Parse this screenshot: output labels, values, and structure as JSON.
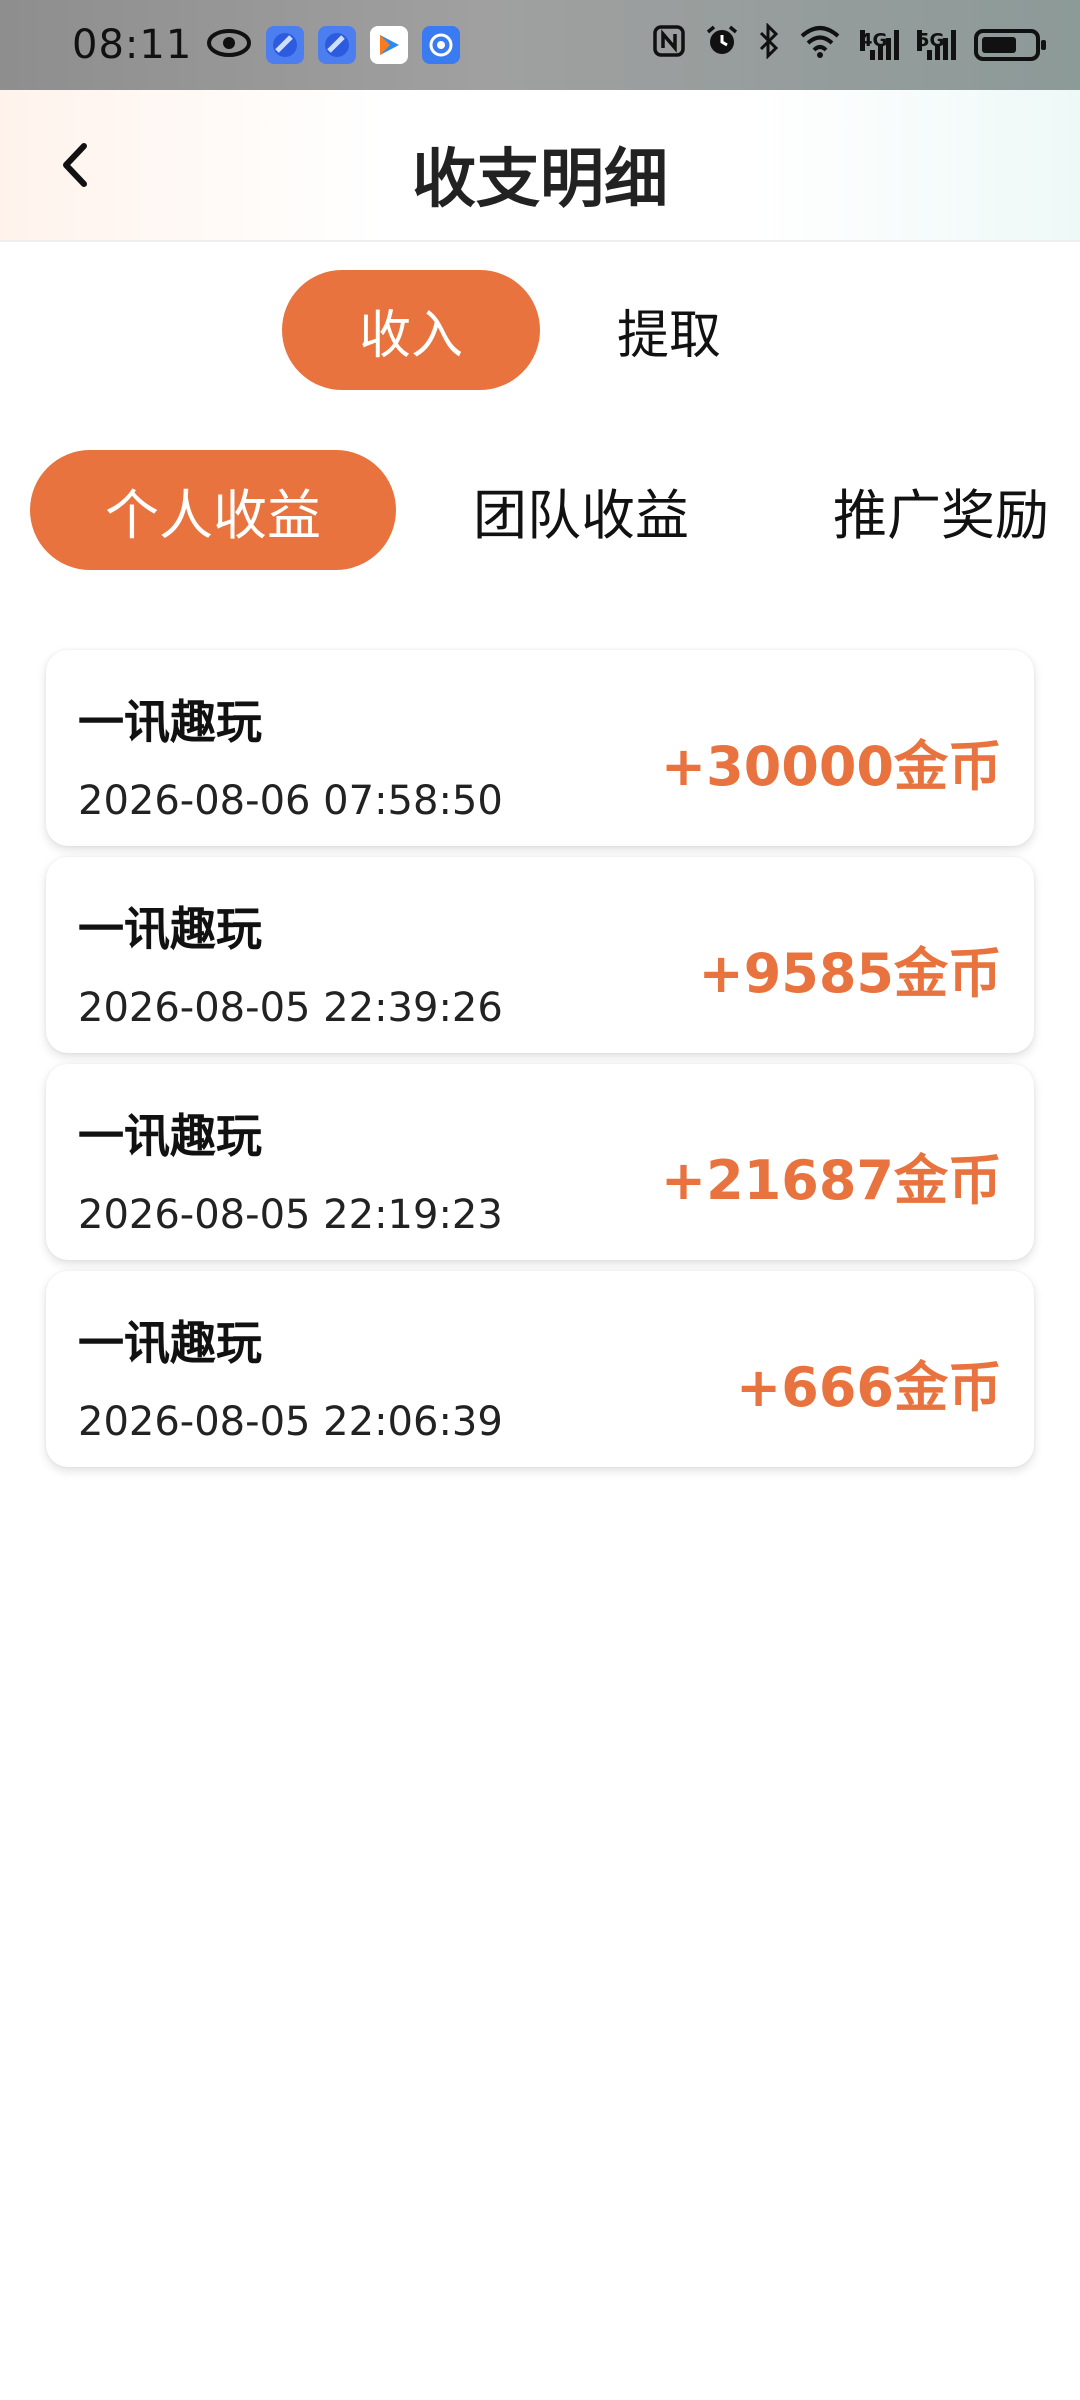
{
  "status_bar": {
    "time": "08:11",
    "left_icons": [
      "eye-icon",
      "app-icon-1",
      "app-icon-2",
      "app-icon-3",
      "app-icon-4"
    ],
    "right_icons": [
      "nfc-icon",
      "alarm-icon",
      "bluetooth-icon",
      "wifi-icon",
      "signal-4g-icon",
      "signal-5g-icon",
      "battery-icon"
    ],
    "signal_labels": [
      "4G",
      "5G"
    ]
  },
  "header": {
    "title": "收支明细",
    "back_icon": "chevron-left-icon"
  },
  "main_tabs": [
    {
      "label": "收入",
      "active": true
    },
    {
      "label": "提取",
      "active": false
    }
  ],
  "sub_tabs": [
    {
      "label": "个人收益",
      "active": true
    },
    {
      "label": "团队收益",
      "active": false
    },
    {
      "label": "推广奖励",
      "active": false
    }
  ],
  "records": [
    {
      "title": "一讯趣玩",
      "time": "2026-08-06 07:58:50",
      "amount": "+30000金币"
    },
    {
      "title": "一讯趣玩",
      "time": "2026-08-05 22:39:26",
      "amount": "+9585金币"
    },
    {
      "title": "一讯趣玩",
      "time": "2026-08-05 22:19:23",
      "amount": "+21687金币"
    },
    {
      "title": "一讯趣玩",
      "time": "2026-08-05 22:06:39",
      "amount": "+666金币"
    }
  ],
  "colors": {
    "accent": "#e8733e"
  }
}
